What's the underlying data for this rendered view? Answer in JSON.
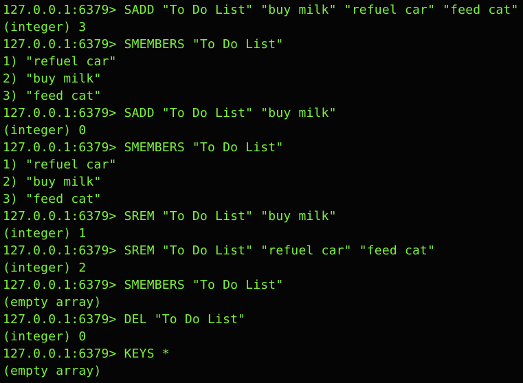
{
  "terminal": {
    "colors": {
      "background": "#050505",
      "text": "#7CF23A"
    },
    "lines": [
      "127.0.0.1:6379> SADD \"To Do List\" \"buy milk\" \"refuel car\" \"feed cat\"",
      "(integer) 3",
      "127.0.0.1:6379> SMEMBERS \"To Do List\"",
      "1) \"refuel car\"",
      "2) \"buy milk\"",
      "3) \"feed cat\"",
      "127.0.0.1:6379> SADD \"To Do List\" \"buy milk\"",
      "(integer) 0",
      "127.0.0.1:6379> SMEMBERS \"To Do List\"",
      "1) \"refuel car\"",
      "2) \"buy milk\"",
      "3) \"feed cat\"",
      "127.0.0.1:6379> SREM \"To Do List\" \"buy milk\"",
      "(integer) 1",
      "127.0.0.1:6379> SREM \"To Do List\" \"refuel car\" \"feed cat\"",
      "(integer) 2",
      "127.0.0.1:6379> SMEMBERS \"To Do List\"",
      "(empty array)",
      "127.0.0.1:6379> DEL \"To Do List\"",
      "(integer) 0",
      "127.0.0.1:6379> KEYS *",
      "(empty array)"
    ]
  }
}
